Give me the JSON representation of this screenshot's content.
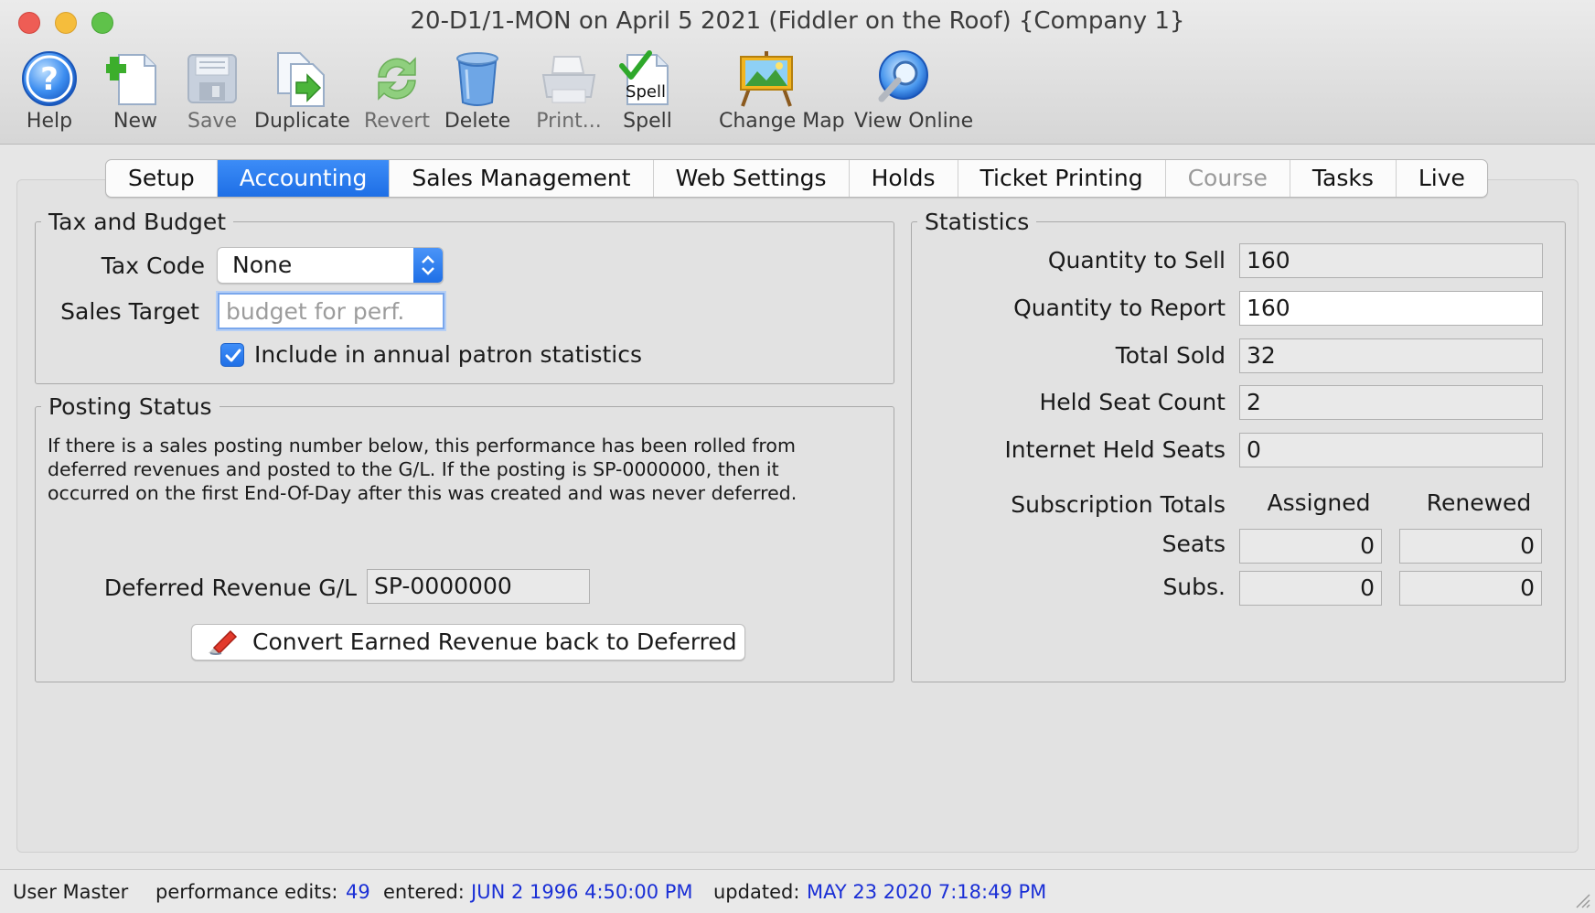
{
  "window": {
    "title": "20-D1/1-MON on April 5 2021 (Fiddler on the Roof) {Company 1}"
  },
  "toolbar": {
    "help_label": "Help",
    "new_label": "New",
    "save_label": "Save",
    "duplicate_label": "Duplicate",
    "revert_label": "Revert",
    "delete_label": "Delete",
    "print_label": "Print...",
    "spell_label": "Spell",
    "spell_icon_text": "Spell",
    "change_map_label": "Change Map",
    "view_online_label": "View Online"
  },
  "tabs": [
    {
      "label": "Setup",
      "state": "normal"
    },
    {
      "label": "Accounting",
      "state": "selected"
    },
    {
      "label": "Sales Management",
      "state": "normal"
    },
    {
      "label": "Web Settings",
      "state": "normal"
    },
    {
      "label": "Holds",
      "state": "normal"
    },
    {
      "label": "Ticket Printing",
      "state": "normal"
    },
    {
      "label": "Course",
      "state": "disabled"
    },
    {
      "label": "Tasks",
      "state": "normal"
    },
    {
      "label": "Live",
      "state": "normal"
    }
  ],
  "tax_budget": {
    "title": "Tax and Budget",
    "tax_code_label": "Tax Code",
    "tax_code_value": "None",
    "sales_target_label": "Sales Target",
    "sales_target_value": "",
    "sales_target_placeholder": "budget for perf.",
    "include_stats_label": "Include in annual patron statistics",
    "include_stats_checked": true
  },
  "posting_status": {
    "title": "Posting Status",
    "info_lines": [
      "If there is a sales posting number below, this performance has been rolled from",
      "deferred revenues and posted to the G/L.  If the posting is SP-0000000, then it",
      "occurred on the first End-Of-Day after this was created and was never deferred."
    ],
    "deferred_gl_label": "Deferred Revenue G/L",
    "deferred_gl_value": "SP-0000000",
    "convert_button_label": "Convert Earned Revenue back to Deferred"
  },
  "statistics": {
    "title": "Statistics",
    "quantity_to_sell_label": "Quantity to Sell",
    "quantity_to_sell": "160",
    "quantity_to_report_label": "Quantity to Report",
    "quantity_to_report": "160",
    "total_sold_label": "Total Sold",
    "total_sold": "32",
    "held_seat_count_label": "Held Seat Count",
    "held_seat_count": "2",
    "internet_held_seats_label": "Internet Held Seats",
    "internet_held_seats": "0",
    "subscription_totals_label": "Subscription Totals",
    "assigned_header": "Assigned",
    "renewed_header": "Renewed",
    "seats_label": "Seats",
    "seats_assigned": "0",
    "seats_renewed": "0",
    "subs_label": "Subs.",
    "subs_assigned": "0",
    "subs_renewed": "0"
  },
  "statusbar": {
    "user": "User Master",
    "edits_label": "performance edits:",
    "edits_value": "49",
    "entered_label": "entered:",
    "entered_value": "JUN 2 1996 4:50:00 PM",
    "updated_label": "updated:",
    "updated_value": "MAY 23 2020 7:18:49 PM"
  },
  "colors": {
    "accent": "#1e6fe6",
    "link_blue": "#1a2fd6"
  }
}
